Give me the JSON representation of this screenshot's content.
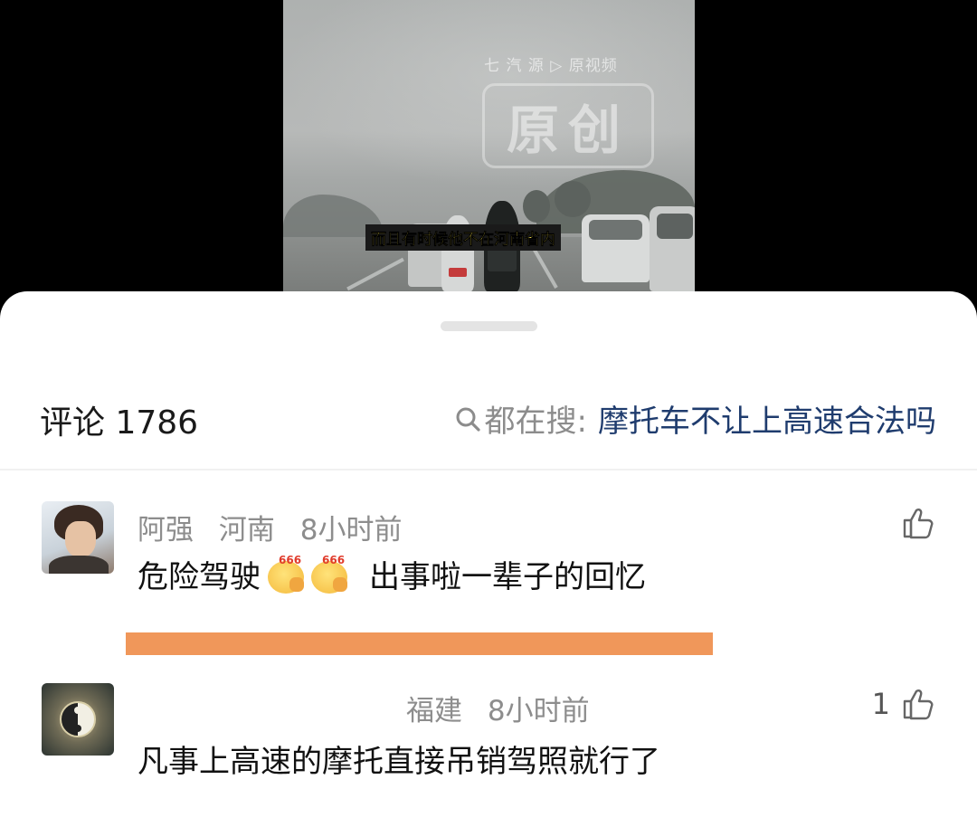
{
  "video": {
    "watermark_logos": "七 汽 源   ▷ 原视频",
    "watermark_stamp": "原创",
    "subtitle": "而且有时候他不在河南省内"
  },
  "comments_header": {
    "title": "评论 1786",
    "hot_search_prefix": "都在搜:",
    "hot_search_query": "摩托车不让上高速合法吗"
  },
  "comments": [
    {
      "username": "阿强",
      "location": "河南",
      "time": "8小时前",
      "text_before": "危险驾驶",
      "emoji_tag": "666",
      "text_after": "出事啦一辈子的回忆",
      "likes": ""
    },
    {
      "username": "",
      "location": "福建",
      "time": "8小时前",
      "text": "凡事上高速的摩托直接吊销驾照就行了",
      "likes": "1"
    }
  ],
  "colors": {
    "accent_query": "#1f3c6e",
    "highlight_bar": "#f0975a",
    "meta_gray": "#8d8d8d"
  }
}
